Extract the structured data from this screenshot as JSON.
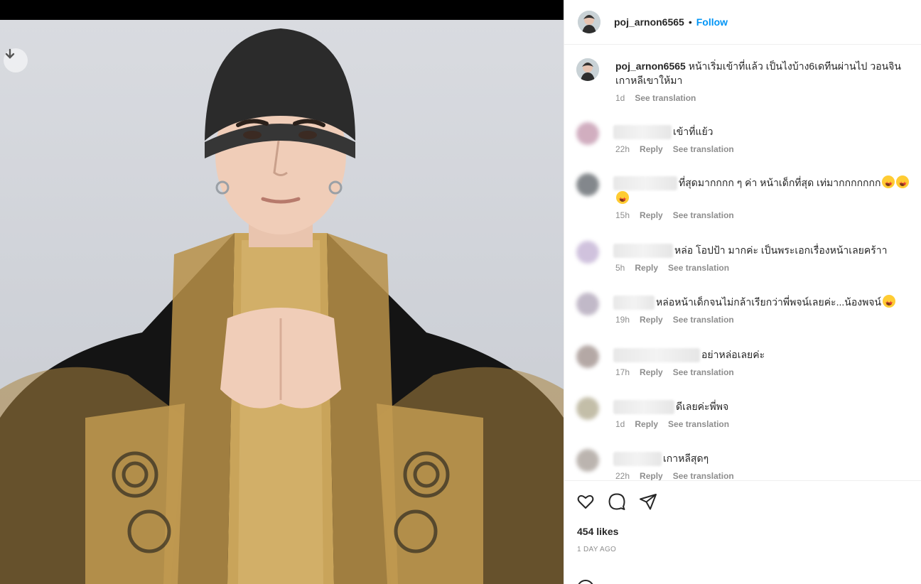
{
  "post": {
    "username": "poj_arnon6565",
    "dot": "•",
    "follow_label": "Follow"
  },
  "caption": {
    "username": "poj_arnon6565",
    "text": "หน้าเริ่มเข้าที่แล้ว เป็นไงบ้าง6เดทีนผ่านไป วอนจินเกาหลีเขาให้มา",
    "time": "1d",
    "see_translation": "See translation"
  },
  "comments": [
    {
      "text": "เข้าที่แย้ว",
      "time": "22h",
      "reply": "Reply",
      "see_translation": "See translation",
      "emoji_count": 0
    },
    {
      "text": "ที่สุดมากกกก ๆ ค่า หน้าเด็กที่สุด เท่มากกกกกกก",
      "time": "15h",
      "reply": "Reply",
      "see_translation": "See translation",
      "emoji_count": 3
    },
    {
      "text": "หล่อ โอปป้า มากค่ะ เป็นพระเอกเรื่องหน้าเลยคร้าา",
      "time": "5h",
      "reply": "Reply",
      "see_translation": "See translation",
      "emoji_count": 0
    },
    {
      "text": "หล่อหน้าเด็กจนไม่กล้าเรียกว่าพี่พจน์เลยค่ะ...น้องพจน์",
      "time": "19h",
      "reply": "Reply",
      "see_translation": "See translation",
      "emoji_count": 1
    },
    {
      "text": "อย่าหล่อเลยค่ะ",
      "time": "17h",
      "reply": "Reply",
      "see_translation": "See translation",
      "emoji_count": 0
    },
    {
      "text": "ดีเลยค่ะพี่พจ",
      "time": "1d",
      "reply": "Reply",
      "see_translation": "See translation",
      "emoji_count": 0
    },
    {
      "text": "เกาหลีสุดๆ",
      "time": "22h",
      "reply": "Reply",
      "see_translation": "See translation",
      "emoji_count": 0
    }
  ],
  "actions": {
    "like_icon": "heart-icon",
    "comment_icon": "comment-icon",
    "share_icon": "share-icon",
    "likes": "454 likes",
    "posted": "1 DAY AGO"
  },
  "colors": {
    "accent": "#0095f6",
    "muted": "#8e8e8e",
    "text": "#262626"
  }
}
